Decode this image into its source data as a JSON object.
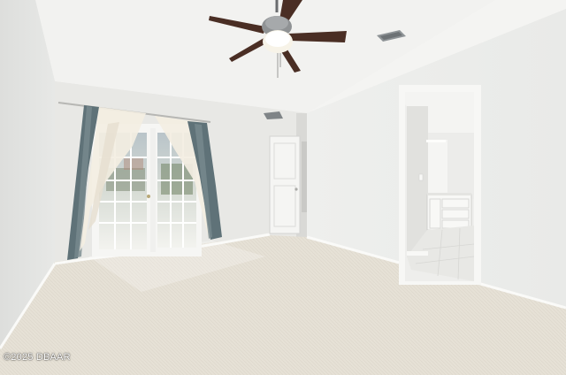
{
  "photo": {
    "watermark": "©2025 DBAAR"
  }
}
